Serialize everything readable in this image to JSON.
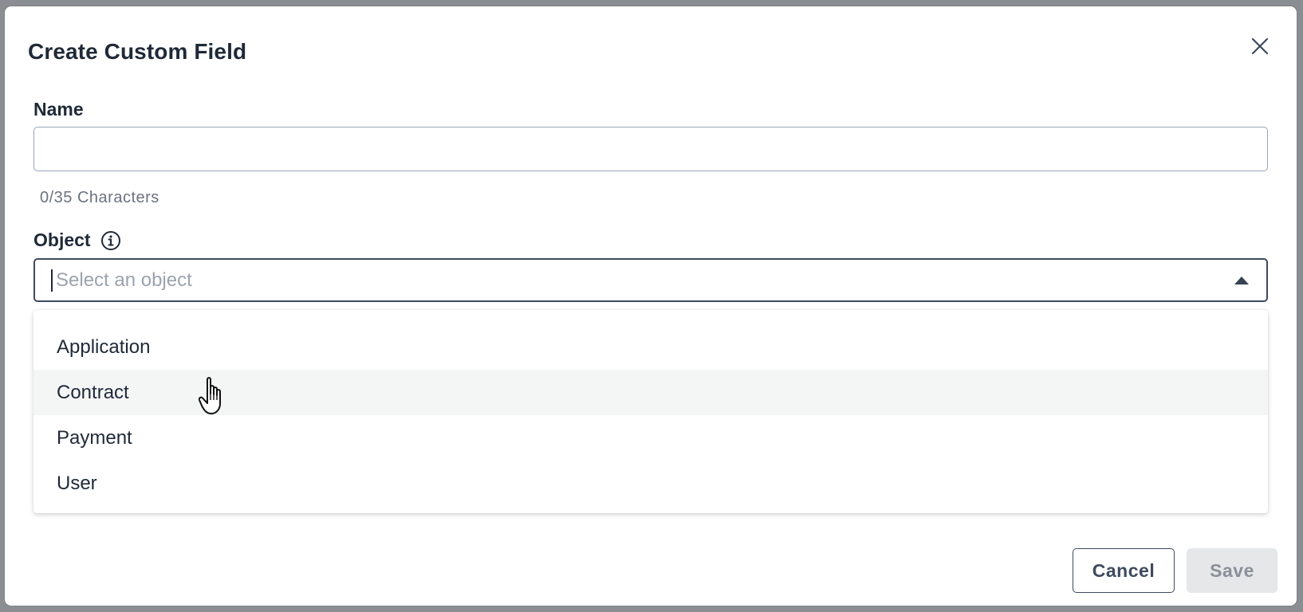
{
  "modal": {
    "title": "Create Custom Field",
    "close_icon": "close-icon"
  },
  "name_field": {
    "label": "Name",
    "value": "",
    "placeholder": "",
    "char_count": "0/35 Characters"
  },
  "object_field": {
    "label": "Object",
    "info_icon": "info-icon",
    "placeholder": "Select an object",
    "options": [
      "Application",
      "Contract",
      "Payment",
      "User"
    ],
    "hovered_option": "Contract"
  },
  "footer": {
    "cancel_label": "Cancel",
    "save_label": "Save"
  }
}
